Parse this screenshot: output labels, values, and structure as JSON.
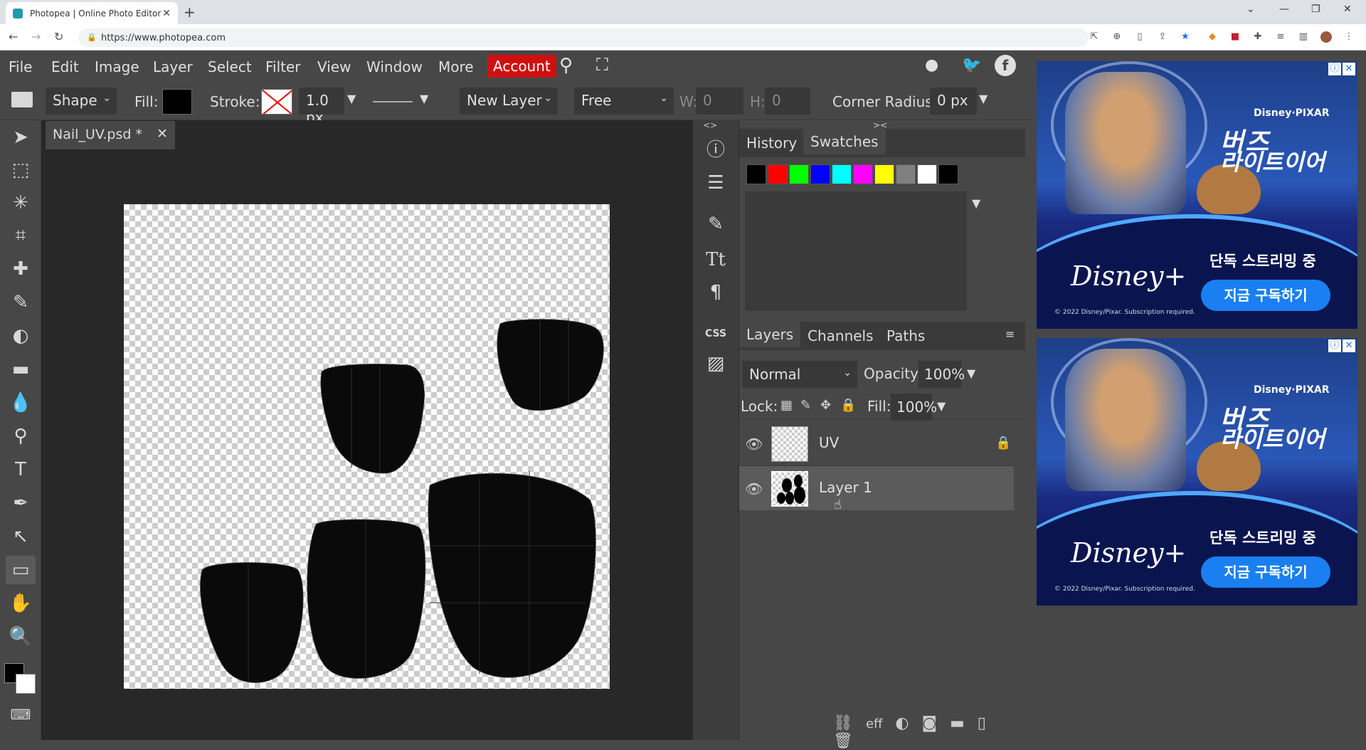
{
  "browser": {
    "tab_title": "Photopea | Online Photo Editor",
    "url": "https://www.photopea.com"
  },
  "menu": {
    "items": [
      "File",
      "Edit",
      "Image",
      "Layer",
      "Select",
      "Filter",
      "View",
      "Window",
      "More"
    ],
    "account": "Account"
  },
  "options": {
    "shape_mode": "Shape",
    "fill_label": "Fill:",
    "stroke_label": "Stroke:",
    "stroke_width": "1.0 px",
    "layer_mode": "New Layer",
    "constraint": "Free",
    "w_label": "W:",
    "w_value": "0",
    "h_label": "H:",
    "h_value": "0",
    "corner_label": "Corner Radius:",
    "corner_value": "0 px"
  },
  "document": {
    "tab_name": "Nail_UV.psd *"
  },
  "panels": {
    "top_tabs": [
      "History",
      "Swatches"
    ],
    "swatch_colors": [
      "#000000",
      "#ff0000",
      "#00ff00",
      "#0000ff",
      "#00ffff",
      "#ff00ff",
      "#ffff00",
      "#808080",
      "#ffffff",
      "#000000"
    ],
    "layer_tabs": [
      "Layers",
      "Channels",
      "Paths"
    ],
    "blend_mode": "Normal",
    "opacity_label": "Opacity:",
    "opacity_value": "100%",
    "lock_label": "Lock:",
    "fill_label": "Fill:",
    "fill_value": "100%",
    "layers": [
      {
        "name": "UV",
        "locked": true,
        "selected": false
      },
      {
        "name": "Layer 1",
        "locked": false,
        "selected": true
      }
    ],
    "bottom_icons": [
      "link-icon",
      "effects-icon",
      "adjustment-icon",
      "mask-icon",
      "folder-icon",
      "new-layer-icon",
      "trash-icon"
    ],
    "effects_label": "eff"
  },
  "ads": {
    "pixar": "Disney·PIXAR",
    "title_kr_1": "버즈",
    "title_kr_2": "라이트이어",
    "brand": "Disney+",
    "stream_text": "단독 스트리밍 중",
    "cta": "지금 구독하기",
    "copyright": "© 2022 Disney/Pixar. Subscription required."
  },
  "side_icons": {
    "css_label": "CSS"
  }
}
